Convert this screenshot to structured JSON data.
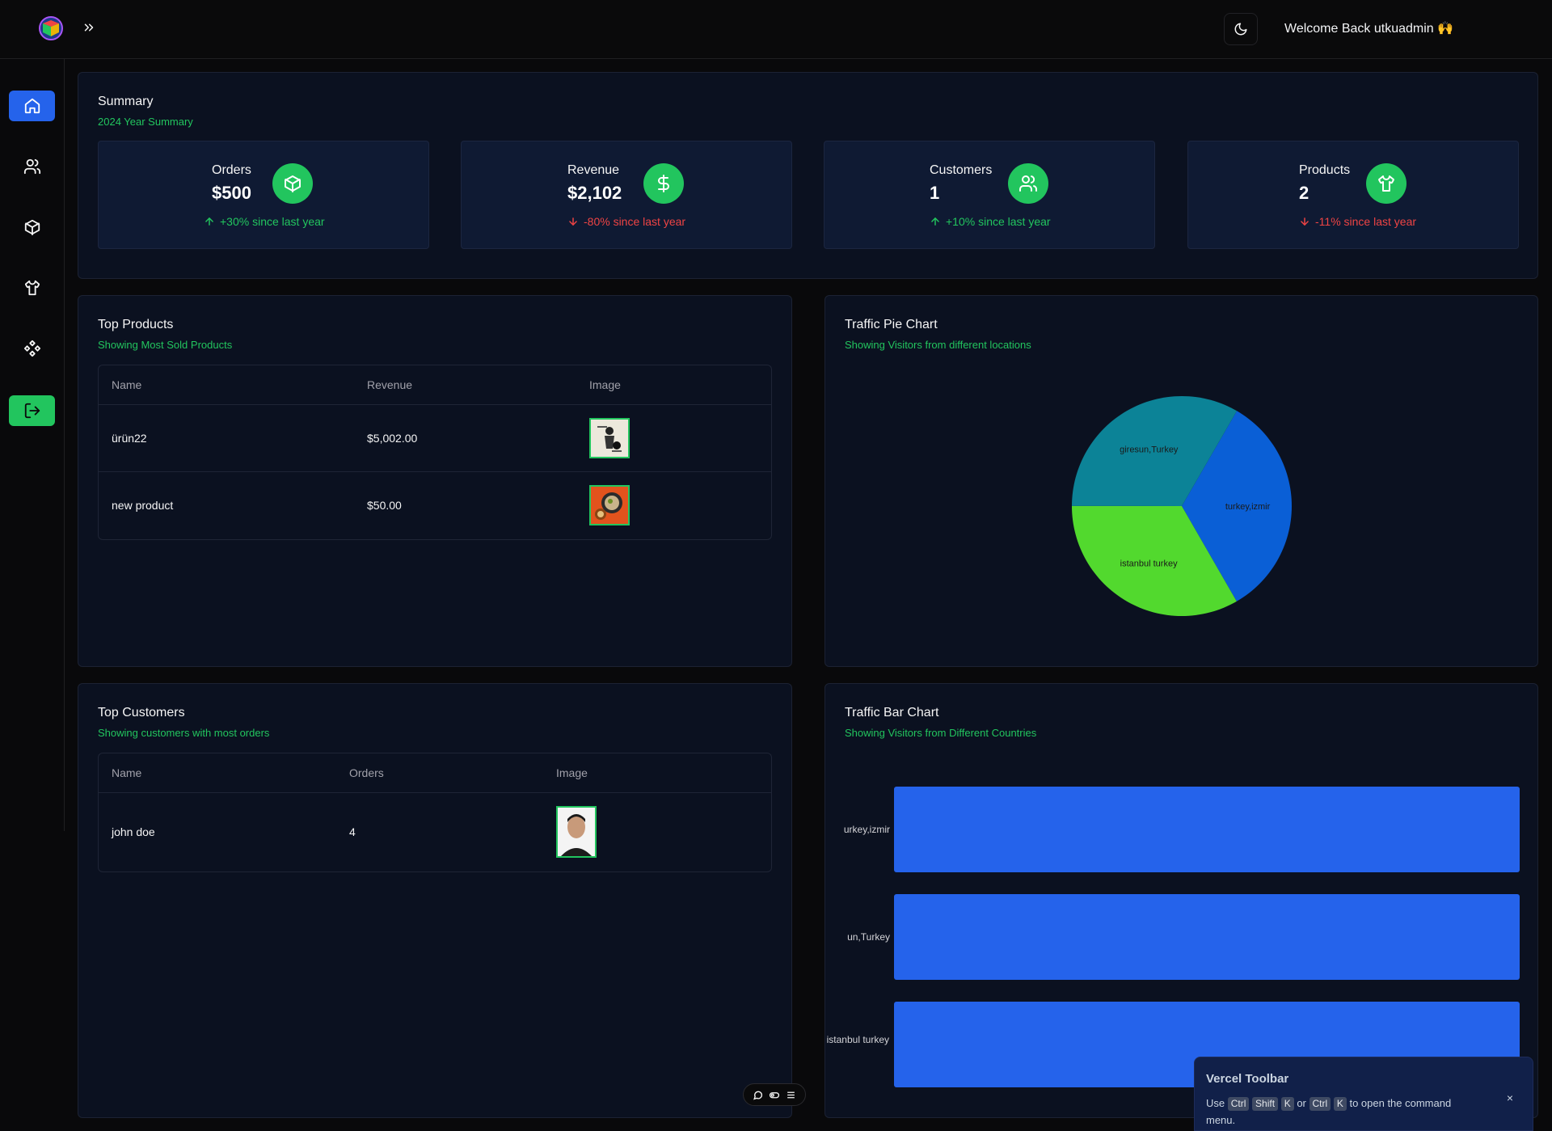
{
  "header": {
    "welcome": "Welcome Back utkuadmin 🙌"
  },
  "sidebar": {
    "items": [
      {
        "icon": "home-icon",
        "active": true
      },
      {
        "icon": "users-icon"
      },
      {
        "icon": "package-icon"
      },
      {
        "icon": "shirt-icon"
      },
      {
        "icon": "components-icon"
      },
      {
        "icon": "logout-icon"
      }
    ]
  },
  "summary": {
    "title": "Summary",
    "subtitle": "2024 Year Summary",
    "stats": [
      {
        "label": "Orders",
        "value": "$500",
        "change": "+30% since last year",
        "direction": "up",
        "icon": "package-icon"
      },
      {
        "label": "Revenue",
        "value": "$2,102",
        "change": "-80% since last year",
        "direction": "down",
        "icon": "dollar-icon"
      },
      {
        "label": "Customers",
        "value": "1",
        "change": "+10% since last year",
        "direction": "up",
        "icon": "users-icon"
      },
      {
        "label": "Products",
        "value": "2",
        "change": "-11% since last year",
        "direction": "down",
        "icon": "shirt-icon"
      }
    ]
  },
  "top_products": {
    "title": "Top Products",
    "subtitle": "Showing Most Sold Products",
    "columns": [
      "Name",
      "Revenue",
      "Image"
    ],
    "rows": [
      {
        "name": "ürün22",
        "revenue": "$5,002.00"
      },
      {
        "name": "new product",
        "revenue": "$50.00"
      }
    ]
  },
  "top_customers": {
    "title": "Top Customers",
    "subtitle": "Showing customers with most orders",
    "columns": [
      "Name",
      "Orders",
      "Image"
    ],
    "rows": [
      {
        "name": "john doe",
        "orders": "4"
      }
    ]
  },
  "pie_card": {
    "title": "Traffic Pie Chart",
    "subtitle": "Showing Visitors from different locations"
  },
  "bar_card": {
    "title": "Traffic Bar Chart",
    "subtitle": "Showing Visitors from Different Countries"
  },
  "chart_data": [
    {
      "type": "pie",
      "title": "Traffic Pie Chart",
      "categories": [
        "turkey,izmir",
        "istanbul turkey",
        "giresun,Turkey"
      ],
      "values": [
        1,
        1,
        1
      ],
      "colors": [
        "#0a5fd6",
        "#52d92e",
        "#0c8397"
      ]
    },
    {
      "type": "bar",
      "orientation": "horizontal",
      "title": "Traffic Bar Chart",
      "categories": [
        "turkey,izmir",
        "giresun,Turkey",
        "istanbul turkey"
      ],
      "tick_labels": [
        "urkey,izmir",
        "un,Turkey",
        "istanbul turkey"
      ],
      "values": [
        1,
        1,
        1
      ],
      "color": "#2563eb"
    }
  ],
  "vercel_toolbar": {
    "title": "Vercel Toolbar",
    "msg_use": "Use",
    "keys1": [
      "Ctrl",
      "Shift",
      "K"
    ],
    "msg_or": "or",
    "keys2": [
      "Ctrl",
      "K"
    ],
    "msg_end": "to open the command menu.",
    "close": "×"
  },
  "colors": {
    "accent_green": "#22c55e",
    "accent_blue": "#2563eb",
    "down_red": "#ef4444"
  }
}
